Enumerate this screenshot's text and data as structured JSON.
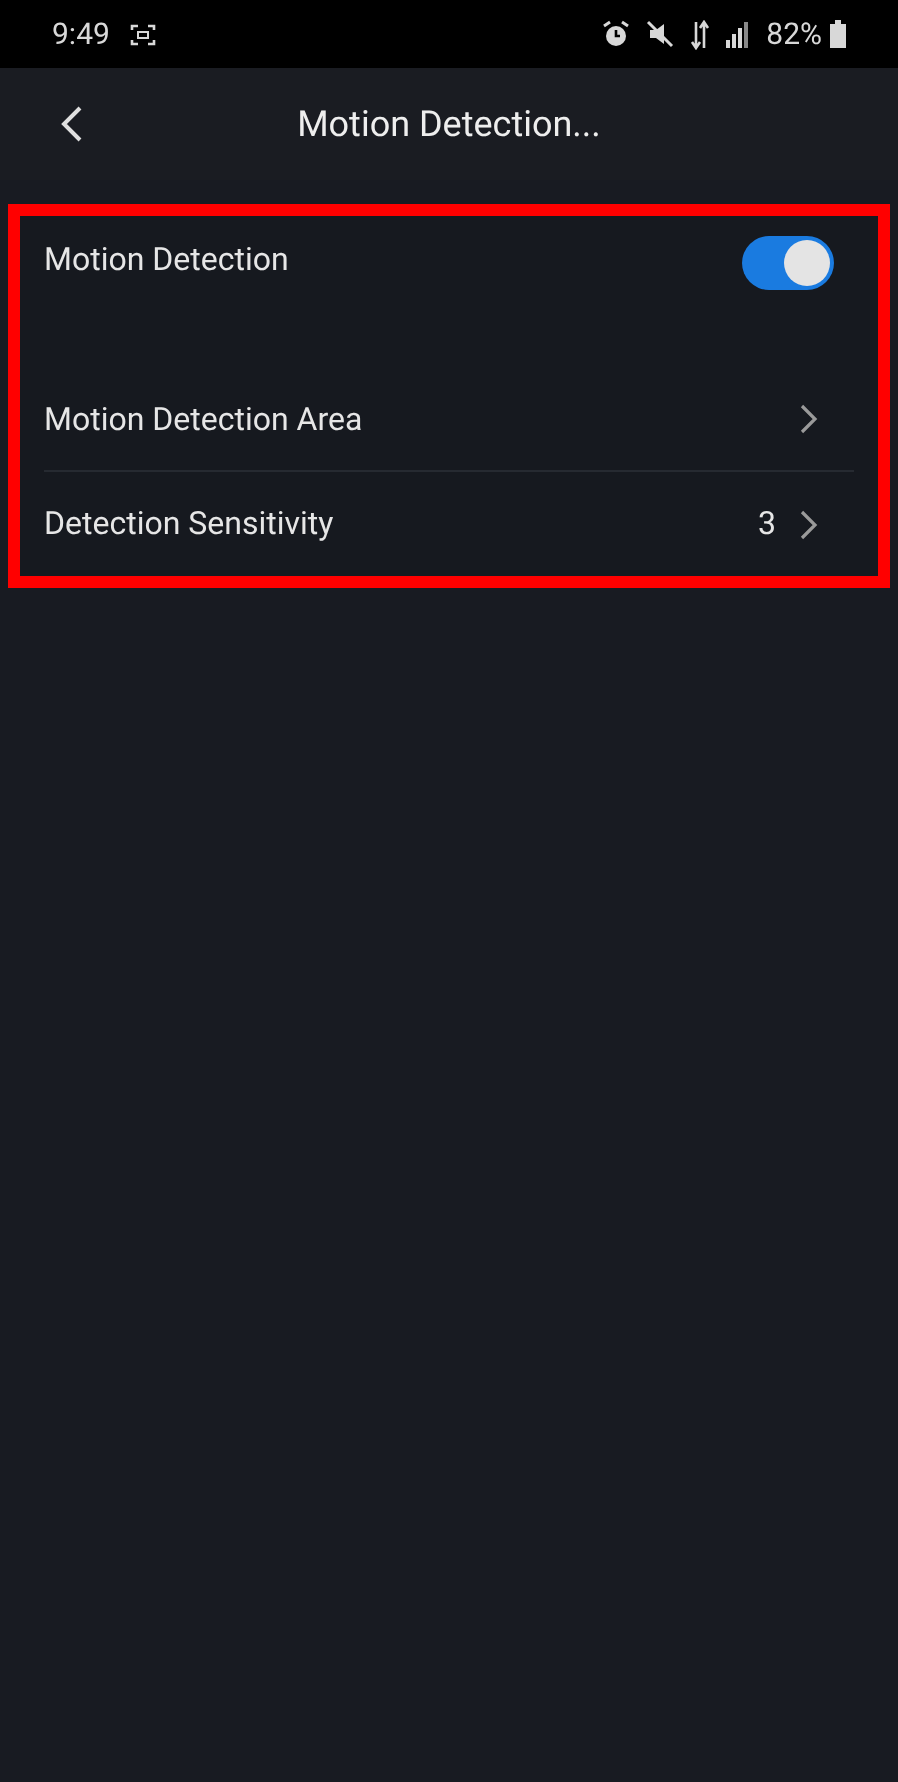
{
  "status_bar": {
    "time": "9:49",
    "battery": "82%"
  },
  "header": {
    "title": "Motion Detection..."
  },
  "settings": [
    {
      "kind": "toggle",
      "label": "Motion Detection",
      "on": true
    },
    {
      "kind": "link",
      "label": "Motion Detection Area"
    },
    {
      "kind": "link",
      "label": "Detection Sensitivity",
      "value": "3"
    }
  ]
}
